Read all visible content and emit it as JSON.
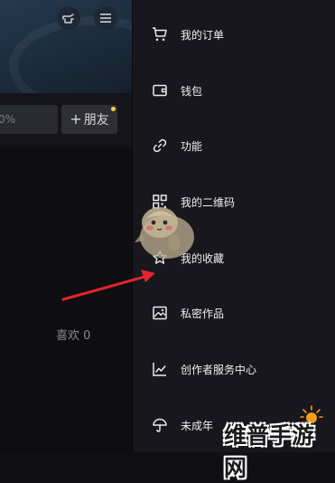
{
  "profile": {
    "percent_value": "0%",
    "add_friend_label": "朋友",
    "likes_tab_label": "喜欢 0"
  },
  "menu": {
    "items": [
      {
        "label": "我的订单",
        "icon": "cart-icon"
      },
      {
        "label": "钱包",
        "icon": "wallet-icon"
      },
      {
        "label": "功能",
        "icon": "link-icon"
      },
      {
        "label": "我的二维码",
        "icon": "qr-code-icon"
      },
      {
        "label": "我的收藏",
        "icon": "star-icon"
      },
      {
        "label": "私密作品",
        "icon": "private-image-icon"
      },
      {
        "label": "创作者服务中心",
        "icon": "chart-line-icon"
      },
      {
        "label": "未成年",
        "icon": "umbrella-icon"
      }
    ]
  },
  "watermark": {
    "text": "维普手游网"
  },
  "colors": {
    "drawer_bg": "#17171d",
    "arrow": "#e0262b",
    "notification_dot": "#ffcf3d"
  }
}
